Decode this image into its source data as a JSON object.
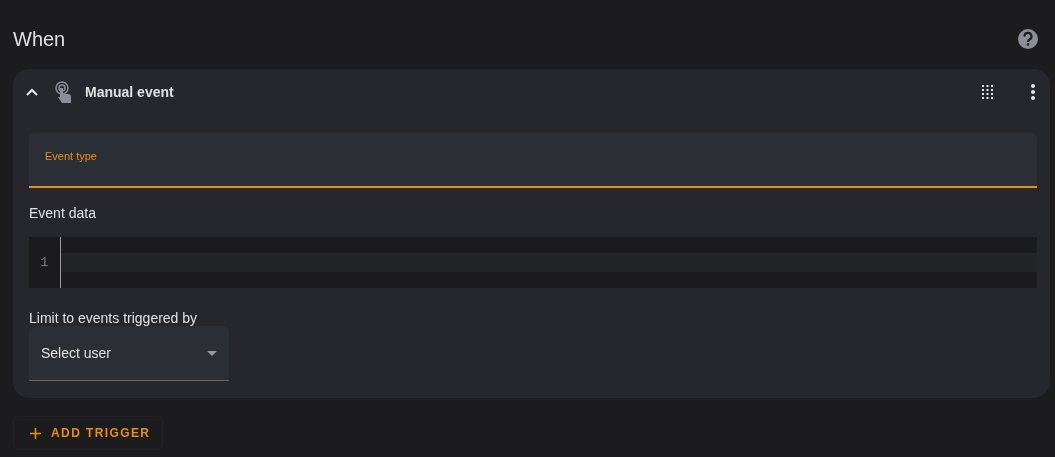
{
  "section": {
    "title": "When"
  },
  "trigger": {
    "title": "Manual event",
    "expanded": true,
    "event_type": {
      "label": "Event type",
      "focused": true
    },
    "event_data": {
      "label": "Event data",
      "line_numbers": [
        "1"
      ]
    },
    "limit": {
      "label": "Limit to events triggered by",
      "placeholder": "Select user"
    }
  },
  "add_button": {
    "label": "ADD TRIGGER"
  }
}
